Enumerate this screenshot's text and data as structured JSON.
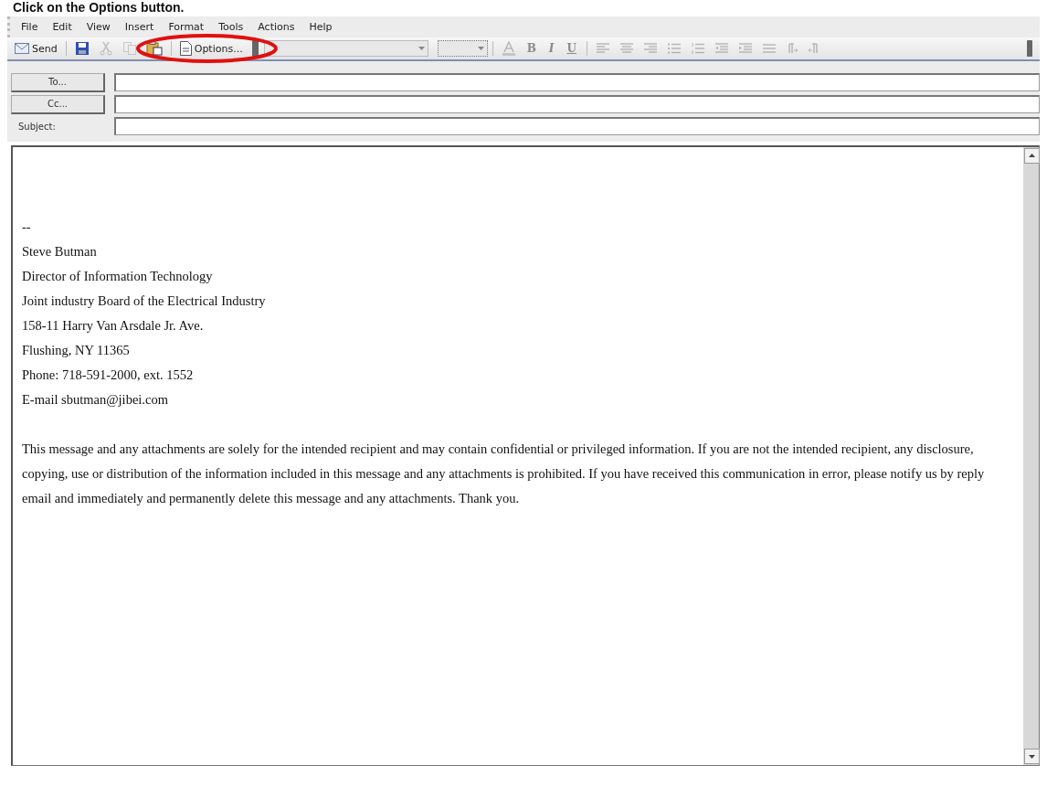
{
  "caption": "Click on the **Options** button.",
  "menu": [
    "File",
    "Edit",
    "View",
    "Insert",
    "Format",
    "Tools",
    "Actions",
    "Help"
  ],
  "toolbar": [
    {
      "kind": "send",
      "label": "Send",
      "disabled": false
    },
    {
      "kind": "save",
      "disabled": false
    },
    {
      "kind": "cut",
      "disabled": true
    },
    {
      "kind": "copy",
      "disabled": true
    },
    {
      "kind": "paste",
      "disabled": false
    },
    {
      "kind": "options",
      "label": "Options...",
      "disabled": false,
      "highlighted": true
    }
  ],
  "format_toolbar": [
    {
      "kind": "font-color",
      "disabled": true
    },
    {
      "kind": "letter",
      "label": "B",
      "disabled": true
    },
    {
      "kind": "letter",
      "label": "I",
      "disabled": true
    },
    {
      "kind": "letter",
      "label": "U",
      "disabled": true
    },
    {
      "kind": "align-left",
      "disabled": true
    },
    {
      "kind": "align-center",
      "disabled": true
    },
    {
      "kind": "align-right",
      "disabled": true
    },
    {
      "kind": "bullets",
      "disabled": true
    },
    {
      "kind": "numbering",
      "disabled": true
    },
    {
      "kind": "outdent",
      "disabled": true
    },
    {
      "kind": "indent",
      "disabled": true
    },
    {
      "kind": "rule",
      "disabled": true
    },
    {
      "kind": "ltr",
      "disabled": true
    },
    {
      "kind": "rtl",
      "disabled": true
    }
  ],
  "fields": [
    {
      "kind": "button",
      "label": "To..."
    },
    {
      "kind": "button",
      "label": "Cc..."
    },
    {
      "kind": "label",
      "label": "Subject:"
    }
  ],
  "body": {
    "signature": [
      "--",
      "Steve Butman",
      "Director of Information Technology",
      "Joint industry Board of the Electrical Industry",
      "158-11 Harry Van Arsdale Jr. Ave.",
      "Flushing, NY 11365",
      "Phone: 718-591-2000, ext. 1552",
      "E-mail sbutman@jibei.com"
    ],
    "disclaimer": "This message and any attachments are solely for the intended recipient and may contain confidential or privileged information. If you are not the intended recipient, any disclosure, copying, use or distribution of the information included in this message and any attachments is prohibited. If you have received this communication in error, please notify us by reply email and immediately and permanently delete this message and any attachments. Thank you."
  }
}
